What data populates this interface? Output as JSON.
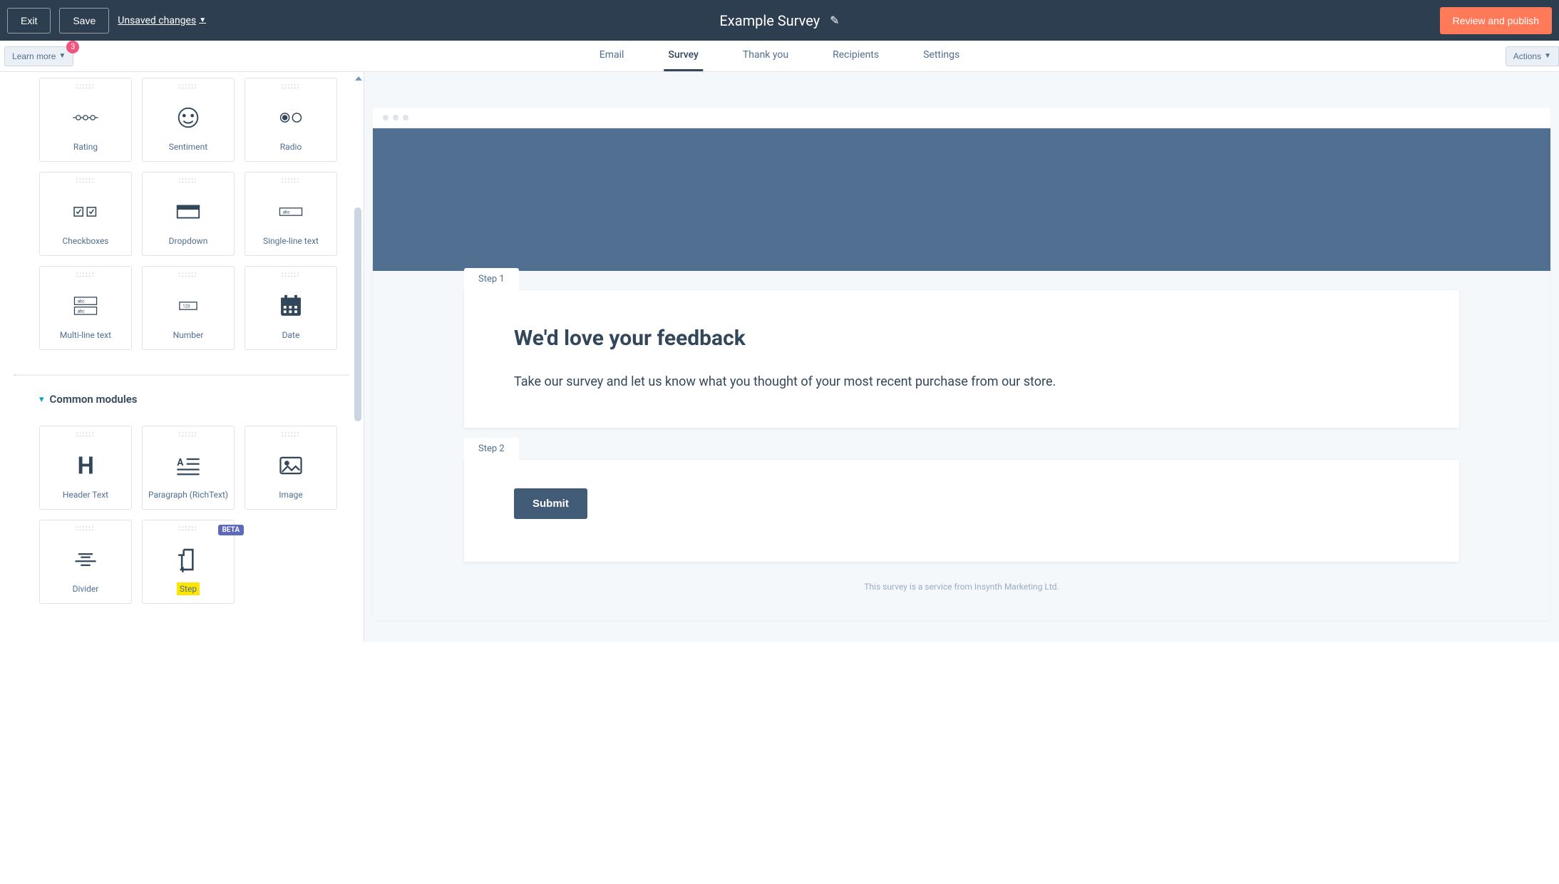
{
  "topbar": {
    "exit": "Exit",
    "save": "Save",
    "unsaved": "Unsaved changes",
    "title": "Example Survey",
    "publish": "Review and publish"
  },
  "row2": {
    "learn_more": "Learn more",
    "badge": "3",
    "tabs": [
      "Email",
      "Survey",
      "Thank you",
      "Recipients",
      "Settings"
    ],
    "active_tab_index": 1,
    "actions": "Actions"
  },
  "modules_row1": [
    {
      "label": "Rating",
      "icon": "rating"
    },
    {
      "label": "Sentiment",
      "icon": "sentiment"
    },
    {
      "label": "Radio",
      "icon": "radio"
    }
  ],
  "modules_row2": [
    {
      "label": "Checkboxes",
      "icon": "checkboxes"
    },
    {
      "label": "Dropdown",
      "icon": "dropdown"
    },
    {
      "label": "Single-line text",
      "icon": "singleline"
    }
  ],
  "modules_row3": [
    {
      "label": "Multi-line text",
      "icon": "multiline"
    },
    {
      "label": "Number",
      "icon": "number"
    },
    {
      "label": "Date",
      "icon": "date"
    }
  ],
  "section_common": "Common modules",
  "common_row1": [
    {
      "label": "Header Text",
      "icon": "header"
    },
    {
      "label": "Paragraph (RichText)",
      "icon": "paragraph"
    },
    {
      "label": "Image",
      "icon": "image"
    }
  ],
  "common_row2": [
    {
      "label": "Divider",
      "icon": "divider",
      "beta": false
    },
    {
      "label": "Step",
      "icon": "step",
      "beta": true,
      "highlight": true
    }
  ],
  "beta_label": "BETA",
  "preview": {
    "step1": "Step 1",
    "heading": "We'd love your feedback",
    "body": "Take our survey and let us know what you thought of your most recent purchase from our store.",
    "step2": "Step 2",
    "submit": "Submit",
    "footnote": "This survey is a service from Insynth Marketing Ltd."
  }
}
